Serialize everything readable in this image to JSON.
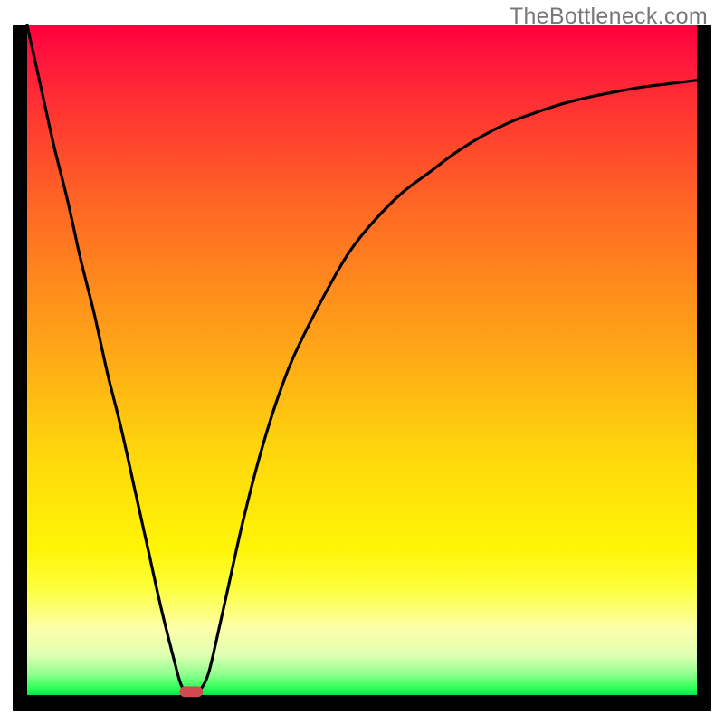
{
  "watermark": "TheBottleneck.com",
  "colors": {
    "frame": "#000000",
    "curve": "#000000",
    "marker": "#d24a4f",
    "gradient_top": "#ff0040",
    "gradient_bottom": "#00e84a"
  },
  "chart_data": {
    "type": "line",
    "title": "",
    "xlabel": "",
    "ylabel": "",
    "xlim": [
      0,
      100
    ],
    "ylim": [
      0,
      100
    ],
    "grid": false,
    "legend": false,
    "annotations": [
      "TheBottleneck.com"
    ],
    "series": [
      {
        "name": "bottleneck-curve",
        "x": [
          0,
          2,
          4,
          6,
          8,
          10,
          12,
          14,
          16,
          18,
          20,
          22,
          23,
          24,
          25,
          26,
          27,
          28,
          30,
          32,
          34,
          36,
          38,
          40,
          44,
          48,
          52,
          56,
          60,
          64,
          68,
          72,
          76,
          80,
          84,
          88,
          92,
          96,
          100
        ],
        "y": [
          100,
          91,
          82,
          74,
          65,
          57,
          48,
          40,
          31,
          22,
          13,
          5,
          1.5,
          0.5,
          0.5,
          1.0,
          3.0,
          7,
          16,
          25,
          33,
          40,
          46,
          51,
          59,
          66,
          71,
          75,
          78,
          81,
          83.5,
          85.5,
          87,
          88.3,
          89.3,
          90.1,
          90.8,
          91.3,
          91.8
        ]
      }
    ],
    "marker": {
      "name": "optimal-region",
      "shape": "pill",
      "x_center": 24.5,
      "y_center": 0.5,
      "width": 3.5,
      "height": 1.6,
      "color": "#d24a4f"
    },
    "background": {
      "type": "vertical-gradient",
      "meaning": "red=high, green=low",
      "stops": [
        {
          "pos": 0.0,
          "color": "#ff0040"
        },
        {
          "pos": 0.5,
          "color": "#ffb114"
        },
        {
          "pos": 0.8,
          "color": "#feff3c"
        },
        {
          "pos": 1.0,
          "color": "#00e84a"
        }
      ]
    }
  }
}
